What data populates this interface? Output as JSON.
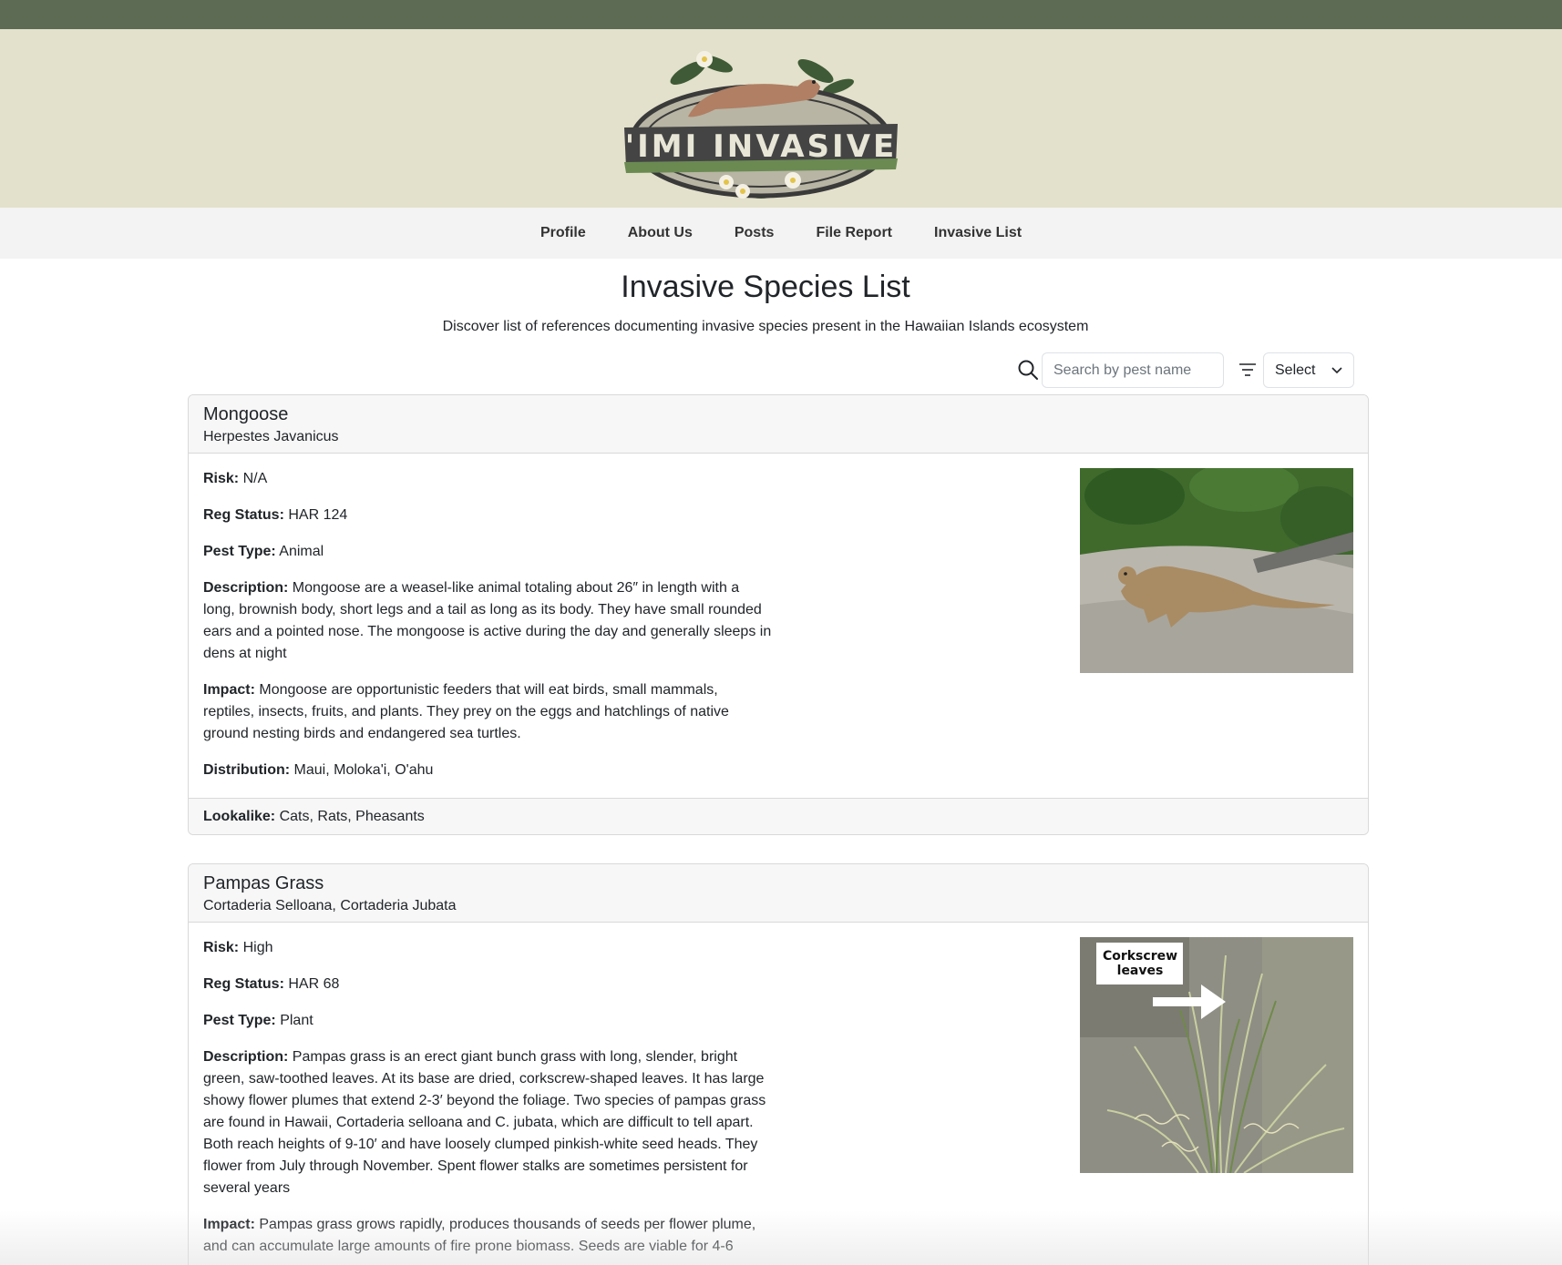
{
  "header": {
    "logo_text": "'IMI INVASIVE"
  },
  "nav": {
    "items": [
      {
        "label": "Profile"
      },
      {
        "label": "About Us"
      },
      {
        "label": "Posts"
      },
      {
        "label": "File Report"
      },
      {
        "label": "Invasive List"
      }
    ]
  },
  "page": {
    "title": "Invasive Species List",
    "subtitle": "Discover list of references documenting invasive species present in the Hawaiian Islands ecosystem"
  },
  "search": {
    "placeholder": "Search by pest name",
    "value": "",
    "icon": "search-icon"
  },
  "filter": {
    "icon": "filter-icon",
    "selected": "Select"
  },
  "labels": {
    "risk": "Risk:",
    "reg_status": "Reg Status:",
    "pest_type": "Pest Type:",
    "description": "Description:",
    "impact": "Impact:",
    "distribution": "Distribution:",
    "lookalike": "Lookalike:"
  },
  "species": [
    {
      "name": "Mongoose",
      "scientific": "Herpestes Javanicus",
      "risk": "N/A",
      "reg_status": "HAR 124",
      "pest_type": "Animal",
      "description": "Mongoose are a weasel-like animal totaling about 26″ in length with a long, brownish body, short legs and a tail as long as its body. They have small rounded ears and a pointed nose. The mongoose is active during the day and generally sleeps in dens at night",
      "impact": "Mongoose are opportunistic feeders that will eat birds, small mammals, reptiles, insects, fruits, and plants. They prey on the eggs and hatchlings of native ground nesting birds and endangered sea turtles.",
      "distribution": "Maui, Moloka'i, O'ahu",
      "lookalike": "Cats, Rats, Pheasants"
    },
    {
      "name": "Pampas Grass",
      "scientific": "Cortaderia Selloana, Cortaderia Jubata",
      "risk": "High",
      "reg_status": "HAR 68",
      "pest_type": "Plant",
      "description": "Pampas grass is an erect giant bunch grass with long, slender, bright green, saw-toothed leaves. At its base are dried, corkscrew-shaped leaves. It has large showy flower plumes that extend 2-3′ beyond the foliage. Two species of pampas grass are found in Hawaii, Cortaderia selloana and C. jubata, which are difficult to tell apart. Both reach heights of 9-10′ and have loosely clumped pinkish-white seed heads. They flower from July through November. Spent flower stalks are sometimes persistent for several years",
      "impact": "Pampas grass grows rapidly, produces thousands of seeds per flower plume, and can accumulate large amounts of fire prone biomass. Seeds are viable for 4-6",
      "photo_label": "Corkscrew leaves"
    }
  ]
}
